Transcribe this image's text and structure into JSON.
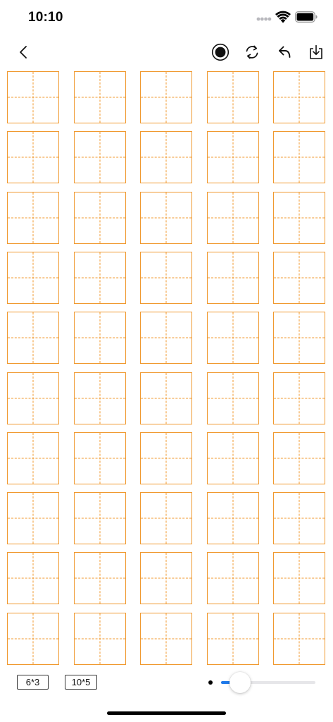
{
  "status_bar": {
    "time": "10:10"
  },
  "toolbar": {
    "icons": {
      "back": "chevron-left-icon",
      "record": "record-icon",
      "refresh": "refresh-icon",
      "undo": "undo-icon",
      "save": "download-icon"
    }
  },
  "grid": {
    "rows": 10,
    "columns": 5,
    "line_color": "#f0992f"
  },
  "bottom": {
    "layout_options": [
      "6*3",
      "10*5"
    ],
    "slider_value": 0.2,
    "accent_color": "#1f7aea"
  }
}
